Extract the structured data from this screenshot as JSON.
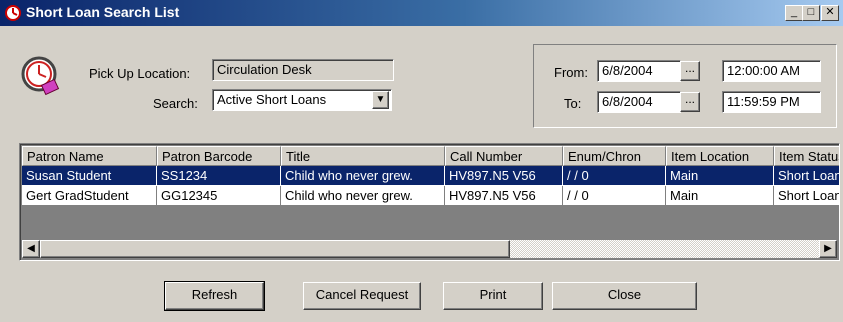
{
  "window": {
    "title": "Short Loan Search List"
  },
  "titlebar_buttons": {
    "minimize": "_",
    "maximize": "□",
    "close": "✕"
  },
  "form": {
    "pickup_label": "Pick Up Location:",
    "pickup_value": "Circulation Desk",
    "search_label": "Search:",
    "search_value": "Active Short Loans"
  },
  "range": {
    "from_label": "From:",
    "from_date": "6/8/2004",
    "from_time": "12:00:00 AM",
    "to_label": "To:",
    "to_date": "6/8/2004",
    "to_time": "11:59:59 PM",
    "picker_label": "..."
  },
  "table": {
    "columns": [
      "Patron Name",
      "Patron Barcode",
      "Title",
      "Call Number",
      "Enum/Chron",
      "Item Location",
      "Item Status"
    ],
    "rows": [
      [
        "Susan Student",
        "SS1234",
        "Child who never grew.",
        "HV897.N5 V56",
        " / / 0",
        "Main",
        "Short Loan"
      ],
      [
        "Gert GradStudent",
        "GG12345",
        "Child who never grew.",
        "HV897.N5 V56",
        " / / 0",
        "Main",
        "Short Loan"
      ]
    ],
    "selected_row": 0
  },
  "buttons": {
    "refresh": "Refresh",
    "cancel_request": "Cancel Request",
    "print": "Print",
    "close": "Close"
  },
  "colors": {
    "titlebar": "#0a246a",
    "selection": "#0a246a",
    "face": "#d4d0c8"
  }
}
